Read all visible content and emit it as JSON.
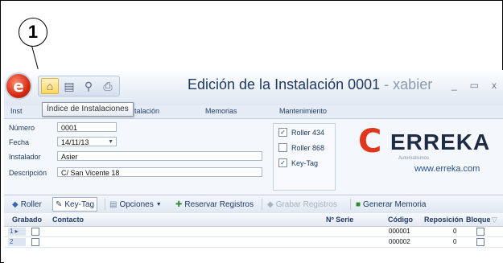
{
  "callout": {
    "number": "1"
  },
  "window": {
    "app_icon": "app-orb-icon",
    "title": "Edición de la Instalación 0001",
    "title_user": " - xabier",
    "minimize": "_",
    "maximize": "▭",
    "close": "x"
  },
  "quick_access": [
    {
      "name": "home-icon",
      "glyph": "⌂"
    },
    {
      "name": "save-icon",
      "glyph": "▤"
    },
    {
      "name": "search-icon",
      "glyph": "⚲"
    },
    {
      "name": "print-icon",
      "glyph": "⎙"
    }
  ],
  "tooltip": "Índice de Instalaciones",
  "menu": {
    "items": [
      "Inst",
      "talación",
      "Memorias",
      "Mantenimiento"
    ]
  },
  "form": {
    "numero_label": "Número",
    "numero_value": "0001",
    "fecha_label": "Fecha",
    "fecha_value": "14/11/13",
    "instalador_label": "Instalador",
    "instalador_value": "Asier",
    "descripcion_label": "Descripción",
    "descripcion_value": "C/ San Vicente 18"
  },
  "checks": [
    {
      "label": "Roller 434",
      "checked": true
    },
    {
      "label": "Roller 868",
      "checked": false
    },
    {
      "label": "Key-Tag",
      "checked": true
    }
  ],
  "logo": {
    "word": "ERREKA",
    "subtitle": "Automatismos",
    "url": "www.erreka.com"
  },
  "toolbar": {
    "roller": "Roller",
    "keytag": "Key-Tag",
    "opciones": "Opciones",
    "reservar": "Reservar Registros",
    "grabar": "Grabar Registros",
    "generar": "Generar Memoria"
  },
  "grid": {
    "headers": {
      "grabado": "Grabado",
      "contacto": "Contacto",
      "serie": "Nº Serie",
      "codigo": "Código",
      "reposicion": "Reposición",
      "bloque": "Bloque"
    },
    "rows": [
      {
        "n": "1",
        "codigo": "000001",
        "reposicion": "0"
      },
      {
        "n": "2",
        "codigo": "000002",
        "reposicion": "0"
      }
    ]
  },
  "colors": {
    "accent": "#e0361c",
    "title": "#1f3a64"
  }
}
